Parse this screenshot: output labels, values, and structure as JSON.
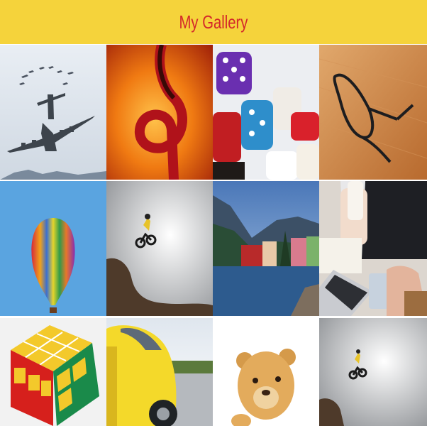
{
  "header": {
    "title": "My Gallery",
    "background": "#f5d33b",
    "title_color": "#d4282a"
  },
  "gallery": {
    "items": [
      {
        "subject": "cargo-plane-and-jets"
      },
      {
        "subject": "treble-clef"
      },
      {
        "subject": "dice"
      },
      {
        "subject": "eyeglasses-on-wood"
      },
      {
        "subject": "hot-air-balloon"
      },
      {
        "subject": "mountain-biker-jump"
      },
      {
        "subject": "lakeside-village"
      },
      {
        "subject": "person-with-laptop-and-phone"
      },
      {
        "subject": "rubiks-cube"
      },
      {
        "subject": "yellow-car"
      },
      {
        "subject": "teddy-bear"
      },
      {
        "subject": "mountain-biker-jump"
      }
    ]
  }
}
